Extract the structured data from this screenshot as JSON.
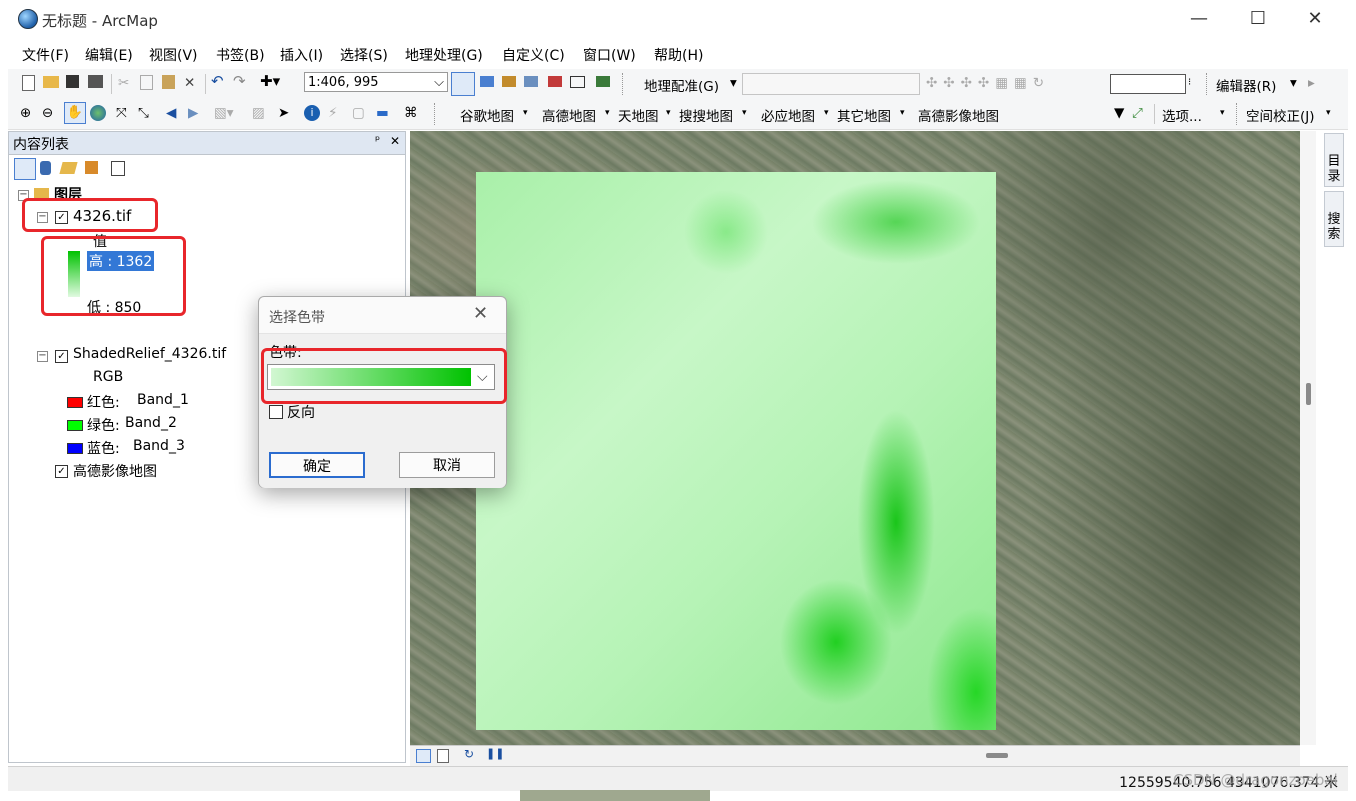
{
  "window": {
    "title": "无标题 - ArcMap",
    "minimize": "—",
    "maximize": "☐",
    "close": "✕"
  },
  "menu": [
    "文件(F)",
    "编辑(E)",
    "视图(V)",
    "书签(B)",
    "插入(I)",
    "选择(S)",
    "地理处理(G)",
    "自定义(C)",
    "窗口(W)",
    "帮助(H)"
  ],
  "toolbar1": {
    "scale": "1:406, 995",
    "georef_label": "地理配准(G)",
    "editor_label": "编辑器(R)"
  },
  "toolbar2": {
    "basemaps": [
      "谷歌地图",
      "高德地图",
      "天地图",
      "搜搜地图",
      "必应地图",
      "其它地图",
      "高德影像地图"
    ],
    "options": "选项...",
    "spatial_adjust": "空间校正(J)"
  },
  "toc": {
    "title": "内容列表",
    "pin": "ᵖ",
    "close": "✕",
    "root": "图层",
    "layer1": {
      "name": "4326.tif",
      "value_header": "值",
      "high": "高 : 1362",
      "low": "低 : 850"
    },
    "layer2": {
      "name": "ShadedRelief_4326.tif",
      "rgb": "RGB",
      "bands": [
        {
          "label": "红色:",
          "band": "Band_1",
          "color": "#ff0000"
        },
        {
          "label": "绿色:",
          "band": "Band_2",
          "color": "#00ff00"
        },
        {
          "label": "蓝色:",
          "band": "Band_3",
          "color": "#0000ff"
        }
      ]
    },
    "layer3": {
      "name": "高德影像地图"
    }
  },
  "dialog": {
    "title": "选择色带",
    "ramp_label": "色带:",
    "reverse_label": "反向",
    "ok": "确定",
    "cancel": "取消",
    "ramp_colors": [
      "#d2f7d2",
      "#00c200"
    ]
  },
  "side_tabs": [
    "目录",
    "搜索"
  ],
  "status": {
    "coords": "12559540.756  4341076.374 米"
  },
  "watermark": "CSDN @dragonzoebai",
  "colors": {
    "highlight": "#e8262b",
    "selection": "#3378d6"
  }
}
